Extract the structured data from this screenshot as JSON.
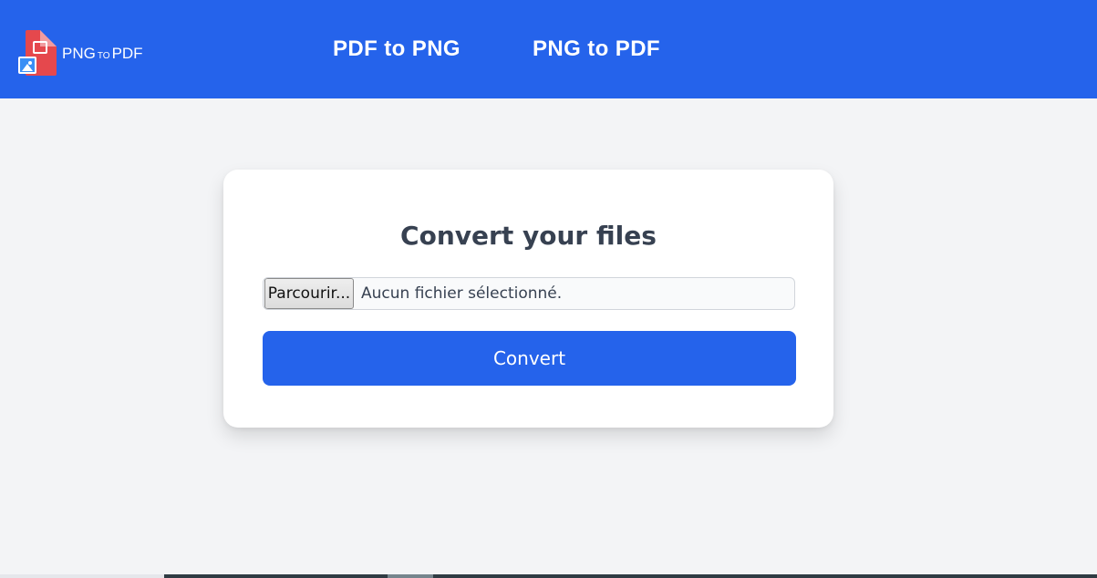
{
  "colors": {
    "primary": "#2563eb",
    "background": "#f3f4f6",
    "card": "#ffffff",
    "title": "#374151",
    "logo_red": "#e5484d",
    "logo_blue": "#3a8ff5"
  },
  "header": {
    "logo": {
      "icon": "pdf-image-document-icon",
      "main": "PNG",
      "small": "TO",
      "tail": "PDF"
    },
    "nav": [
      {
        "label": "PDF to PNG"
      },
      {
        "label": "PNG to PDF"
      }
    ]
  },
  "converter": {
    "title": "Convert your files",
    "file_button": "Parcourir...",
    "file_status": "Aucun fichier sélectionné.",
    "submit": "Convert"
  }
}
